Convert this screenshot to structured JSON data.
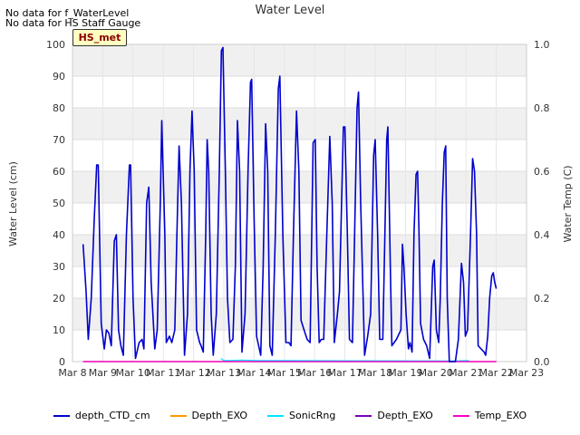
{
  "notes": [
    "No data for f_WaterLevel",
    "No data for HS Staff Gauge"
  ],
  "badge": "HS_met",
  "chart_data": {
    "type": "line",
    "title": "Water Level",
    "ylabel": "Water Level (cm)",
    "y2label": "Water Temp (C)",
    "ylim": [
      0,
      100
    ],
    "y2lim": [
      0,
      1.0
    ],
    "yticks": [
      0,
      10,
      20,
      30,
      40,
      50,
      60,
      70,
      80,
      90,
      100
    ],
    "y2ticks": [
      "0.0",
      "0.2",
      "0.4",
      "0.6",
      "0.8",
      "1.0"
    ],
    "xlim": [
      8,
      23
    ],
    "xticks": [
      "Mar 8",
      "Mar 9",
      "Mar 10",
      "Mar 11",
      "Mar 12",
      "Mar 13",
      "Mar 14",
      "Mar 15",
      "Mar 16",
      "Mar 17",
      "Mar 18",
      "Mar 19",
      "Mar 20",
      "Mar 21",
      "Mar 22",
      "Mar 23"
    ],
    "grid": true,
    "legend_position": "bottom",
    "series": [
      {
        "name": "depth_CTD_cm",
        "color": "#0000cc",
        "points": [
          [
            8.35,
            37
          ],
          [
            8.45,
            22
          ],
          [
            8.52,
            7
          ],
          [
            8.62,
            20
          ],
          [
            8.72,
            45
          ],
          [
            8.8,
            62
          ],
          [
            8.85,
            62
          ],
          [
            8.95,
            12
          ],
          [
            9.05,
            4
          ],
          [
            9.12,
            10
          ],
          [
            9.2,
            9
          ],
          [
            9.28,
            5
          ],
          [
            9.38,
            38
          ],
          [
            9.45,
            40
          ],
          [
            9.52,
            10
          ],
          [
            9.6,
            5
          ],
          [
            9.68,
            2
          ],
          [
            9.78,
            40
          ],
          [
            9.88,
            62
          ],
          [
            9.92,
            62
          ],
          [
            10.0,
            20
          ],
          [
            10.08,
            1
          ],
          [
            10.2,
            6
          ],
          [
            10.3,
            7
          ],
          [
            10.36,
            4
          ],
          [
            10.45,
            50
          ],
          [
            10.52,
            55
          ],
          [
            10.6,
            25
          ],
          [
            10.72,
            4
          ],
          [
            10.8,
            10
          ],
          [
            10.9,
            50
          ],
          [
            10.95,
            76
          ],
          [
            11.05,
            40
          ],
          [
            11.1,
            6
          ],
          [
            11.2,
            8
          ],
          [
            11.28,
            6
          ],
          [
            11.38,
            10
          ],
          [
            11.45,
            40
          ],
          [
            11.52,
            68
          ],
          [
            11.6,
            50
          ],
          [
            11.7,
            2
          ],
          [
            11.8,
            15
          ],
          [
            11.88,
            60
          ],
          [
            11.95,
            79
          ],
          [
            12.02,
            60
          ],
          [
            12.1,
            10
          ],
          [
            12.2,
            6
          ],
          [
            12.25,
            5
          ],
          [
            12.32,
            3
          ],
          [
            12.4,
            40
          ],
          [
            12.45,
            70
          ],
          [
            12.5,
            60
          ],
          [
            12.58,
            15
          ],
          [
            12.65,
            2
          ],
          [
            12.75,
            15
          ],
          [
            12.85,
            60
          ],
          [
            12.92,
            98
          ],
          [
            12.97,
            99
          ],
          [
            13.05,
            60
          ],
          [
            13.12,
            20
          ],
          [
            13.2,
            6
          ],
          [
            13.3,
            7
          ],
          [
            13.38,
            30
          ],
          [
            13.45,
            76
          ],
          [
            13.52,
            60
          ],
          [
            13.6,
            3
          ],
          [
            13.7,
            15
          ],
          [
            13.8,
            60
          ],
          [
            13.88,
            88
          ],
          [
            13.92,
            89
          ],
          [
            14.0,
            45
          ],
          [
            14.08,
            8
          ],
          [
            14.15,
            5
          ],
          [
            14.22,
            2
          ],
          [
            14.3,
            30
          ],
          [
            14.38,
            75
          ],
          [
            14.45,
            60
          ],
          [
            14.52,
            5
          ],
          [
            14.6,
            2
          ],
          [
            14.7,
            40
          ],
          [
            14.8,
            86
          ],
          [
            14.85,
            90
          ],
          [
            14.95,
            40
          ],
          [
            15.05,
            6
          ],
          [
            15.15,
            6
          ],
          [
            15.22,
            5
          ],
          [
            15.3,
            40
          ],
          [
            15.4,
            79
          ],
          [
            15.48,
            60
          ],
          [
            15.55,
            13
          ],
          [
            15.65,
            10
          ],
          [
            15.75,
            7
          ],
          [
            15.85,
            6
          ],
          [
            15.95,
            69
          ],
          [
            16.02,
            70
          ],
          [
            16.08,
            30
          ],
          [
            16.15,
            6
          ],
          [
            16.22,
            7
          ],
          [
            16.3,
            7
          ],
          [
            16.4,
            40
          ],
          [
            16.5,
            71
          ],
          [
            16.58,
            50
          ],
          [
            16.65,
            6
          ],
          [
            16.75,
            15
          ],
          [
            16.82,
            22
          ],
          [
            16.95,
            74
          ],
          [
            17.0,
            74
          ],
          [
            17.08,
            40
          ],
          [
            17.15,
            7
          ],
          [
            17.25,
            6
          ],
          [
            17.32,
            40
          ],
          [
            17.4,
            80
          ],
          [
            17.45,
            85
          ],
          [
            17.52,
            50
          ],
          [
            17.65,
            2
          ],
          [
            17.75,
            8
          ],
          [
            17.85,
            15
          ],
          [
            17.95,
            65
          ],
          [
            18.0,
            70
          ],
          [
            18.08,
            40
          ],
          [
            18.15,
            7
          ],
          [
            18.25,
            7
          ],
          [
            18.32,
            40
          ],
          [
            18.38,
            70
          ],
          [
            18.42,
            74
          ],
          [
            18.5,
            30
          ],
          [
            18.55,
            5
          ],
          [
            18.7,
            7
          ],
          [
            18.85,
            10
          ],
          [
            18.9,
            37
          ],
          [
            18.95,
            30
          ],
          [
            19.02,
            15
          ],
          [
            19.1,
            4
          ],
          [
            19.15,
            6
          ],
          [
            19.22,
            3
          ],
          [
            19.28,
            40
          ],
          [
            19.35,
            59
          ],
          [
            19.4,
            60
          ],
          [
            19.45,
            40
          ],
          [
            19.5,
            12
          ],
          [
            19.6,
            7
          ],
          [
            19.7,
            5
          ],
          [
            19.8,
            1
          ],
          [
            19.9,
            30
          ],
          [
            19.95,
            32
          ],
          [
            20.02,
            10
          ],
          [
            20.1,
            6
          ],
          [
            20.15,
            20
          ],
          [
            20.22,
            50
          ],
          [
            20.28,
            66
          ],
          [
            20.33,
            68
          ],
          [
            20.38,
            20
          ],
          [
            20.45,
            0
          ],
          [
            20.55,
            0
          ],
          [
            20.65,
            0
          ],
          [
            20.75,
            7
          ],
          [
            20.85,
            31
          ],
          [
            20.92,
            25
          ],
          [
            20.98,
            8
          ],
          [
            21.05,
            10
          ],
          [
            21.15,
            40
          ],
          [
            21.22,
            64
          ],
          [
            21.28,
            60
          ],
          [
            21.35,
            40
          ],
          [
            21.4,
            5
          ],
          [
            21.5,
            4
          ],
          [
            21.6,
            3
          ],
          [
            21.65,
            2
          ],
          [
            21.72,
            8
          ],
          [
            21.78,
            20
          ],
          [
            21.85,
            27
          ],
          [
            21.9,
            28
          ],
          [
            21.95,
            25
          ],
          [
            22.0,
            23
          ]
        ]
      },
      {
        "name": "Depth_EXO",
        "color": "#ff9900",
        "points": [
          [
            8.35,
            0
          ],
          [
            22.0,
            0
          ]
        ]
      },
      {
        "name": "SonicRng",
        "color": "#00e5ff",
        "points": [
          [
            12.9,
            1
          ],
          [
            13.0,
            0.3
          ],
          [
            13.2,
            0.3
          ],
          [
            13.6,
            0.5
          ],
          [
            14.0,
            0.3
          ],
          [
            14.6,
            0.3
          ],
          [
            15.0,
            0.3
          ],
          [
            20.6,
            0.2
          ],
          [
            21.1,
            0.3
          ]
        ]
      },
      {
        "name": "Depth_EXO",
        "color": "#7700bb",
        "points": [
          [
            8.35,
            0
          ],
          [
            22.0,
            0
          ]
        ]
      },
      {
        "name": "Temp_EXO",
        "color": "#ff00cc",
        "points": [
          [
            8.35,
            0
          ],
          [
            22.0,
            0
          ]
        ]
      }
    ]
  }
}
